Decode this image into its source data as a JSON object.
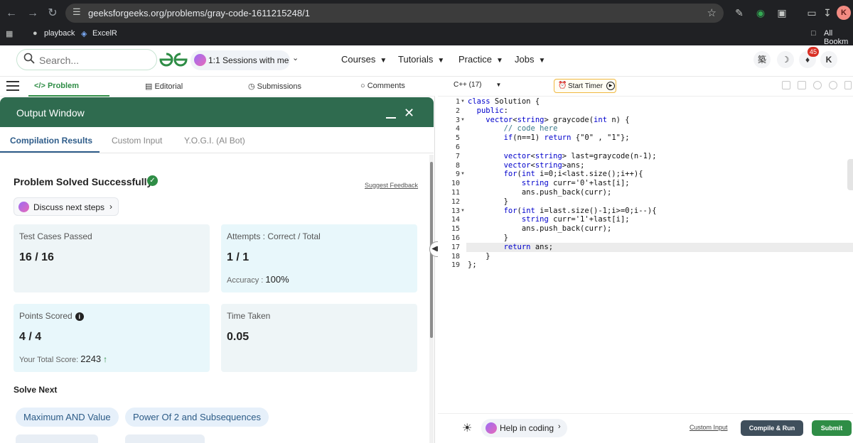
{
  "browser": {
    "url": "geeksforgeeks.org/problems/gray-code-1611215248/1",
    "bookmarks": [
      "playback",
      "ExcelR"
    ],
    "all_bookmarks": "All Bookm",
    "profile_initial": "K"
  },
  "header": {
    "search_placeholder": "Search...",
    "sessions_label": "1:1 Sessions with me",
    "nav": [
      "Courses",
      "Tutorials",
      "Practice",
      "Jobs"
    ],
    "notification_count": "45",
    "avatar_initial": "K"
  },
  "problem_tabs": [
    "Problem",
    "Editorial",
    "Submissions",
    "Comments"
  ],
  "output_window": {
    "title": "Output Window",
    "tabs": [
      "Compilation Results",
      "Custom Input",
      "Y.O.G.I. (AI Bot)"
    ],
    "status": "Problem Solved Successfully",
    "suggest_feedback": "Suggest Feedback",
    "discuss_label": "Discuss next steps",
    "cards": {
      "tests_label": "Test Cases Passed",
      "tests_value": "16 / 16",
      "attempts_label": "Attempts : Correct / Total",
      "attempts_value": "1 / 1",
      "accuracy_label": "Accuracy :",
      "accuracy_value": "100%",
      "points_label": "Points Scored",
      "points_value": "4 / 4",
      "total_label": "Your Total Score:",
      "total_value": "2243",
      "time_label": "Time Taken",
      "time_value": "0.05"
    },
    "solve_next_title": "Solve Next",
    "solve_next": [
      "Maximum AND Value",
      "Power Of 2 and Subsequences"
    ]
  },
  "editor": {
    "language": "C++ (17)",
    "start_timer": "Start Timer",
    "code_lines": [
      "class Solution {",
      "  public:",
      "    vector<string> graycode(int n) {",
      "        // code here",
      "        if(n==1) return {\"0\" , \"1\"};",
      "",
      "        vector<string> last=graycode(n-1);",
      "        vector<string>ans;",
      "        for(int i=0;i<last.size();i++){",
      "            string curr='0'+last[i];",
      "            ans.push_back(curr);",
      "        }",
      "        for(int i=last.size()-1;i>=0;i--){",
      "            string curr='1'+last[i];",
      "            ans.push_back(curr);",
      "        }",
      "        return ans;",
      "    }",
      "};"
    ],
    "active_line": 17,
    "help_coding": "Help in coding",
    "custom_input": "Custom Input",
    "compile_run": "Compile & Run",
    "submit": "Submit"
  },
  "colors": {
    "brand_green": "#2f8d46",
    "output_header": "#2f6b4f",
    "keyword": "#0000cc"
  }
}
